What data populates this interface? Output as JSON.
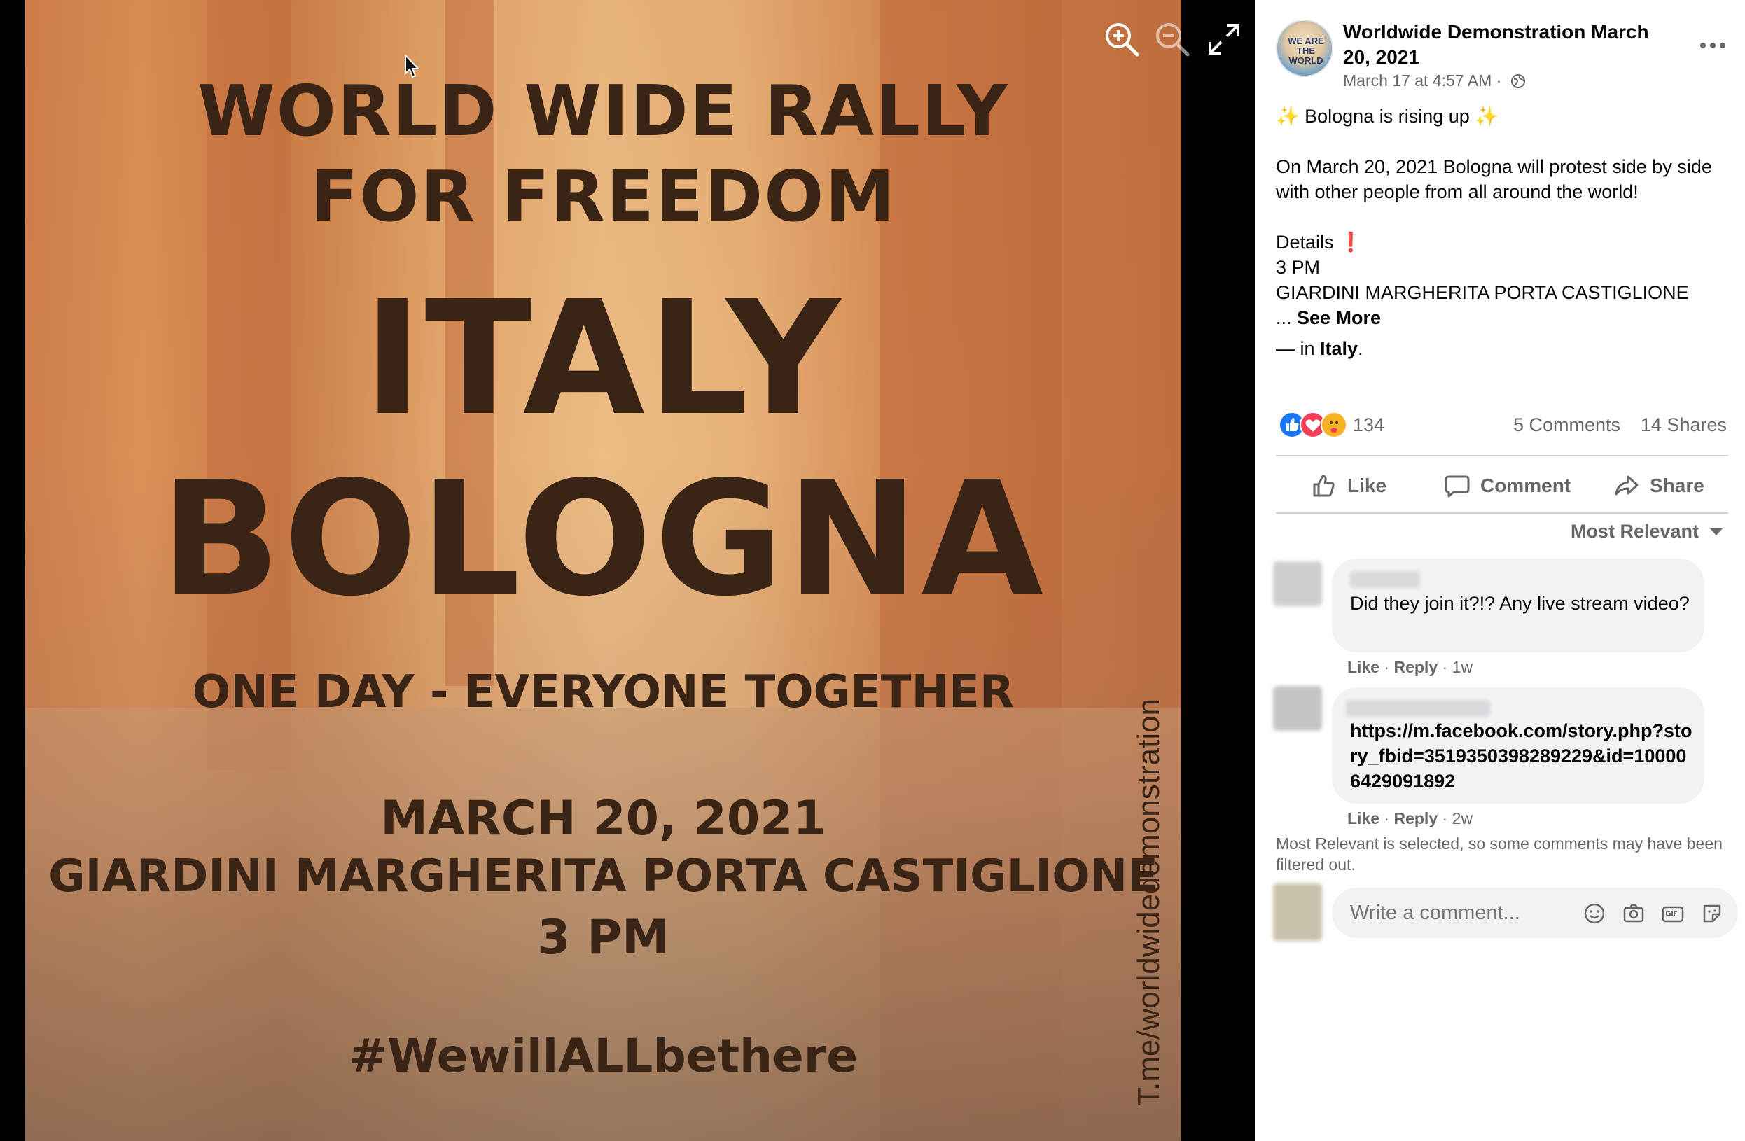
{
  "poster": {
    "line1": "WORLD WIDE RALLY",
    "line2": "FOR FREEDOM",
    "country": "ITALY",
    "city": "BOLOGNA",
    "tagline": "ONE DAY - EVERYONE TOGETHER",
    "date": "MARCH 20, 2021",
    "venue": "GIARDINI MARGHERITA PORTA CASTIGLIONE",
    "time": "3 PM",
    "hashtag": "#WewillALLbethere",
    "side_url": "T.me/worldwidedemonstration"
  },
  "viewer": {
    "zoom_in_icon": "zoom-in-icon",
    "zoom_out_icon": "zoom-out-icon",
    "fullscreen_icon": "fullscreen-icon"
  },
  "post": {
    "avatar_text": "WE ARE THE WORLD",
    "author": "Worldwide Demonstration March 20, 2021",
    "meta": "March 17 at 4:57 AM · ",
    "body_line1": "✨ Bologna is rising up ✨",
    "body_line2": "On March 20, 2021 Bologna will protest side by side with other people from all around the world!",
    "details_label": "Details ❗",
    "details_time": "3 PM",
    "details_place": "GIARDINI MARGHERITA PORTA CASTIGLIONE",
    "see_more_prefix": "... ",
    "see_more": "See More",
    "location_prefix": "— in ",
    "location": "Italy",
    "location_suffix": "."
  },
  "stats": {
    "reactions": "134",
    "comments": "5 Comments",
    "shares": "14 Shares"
  },
  "actions": {
    "like": "Like",
    "comment": "Comment",
    "share": "Share"
  },
  "sort": {
    "label": "Most Relevant"
  },
  "comments": [
    {
      "text": "Did they join it?!? Any live stream video?",
      "like": "Like",
      "reply": "Reply",
      "time": "1w"
    },
    {
      "text": "https://m.facebook.com/story.php?story_fbid=3519350398289229&id=100006429091892",
      "like": "Like",
      "reply": "Reply",
      "time": "2w"
    }
  ],
  "filter_note": "Most Relevant is selected, so some comments may have been filtered out.",
  "composer": {
    "placeholder": "Write a comment..."
  },
  "colors": {
    "facebook_blue": "#1877f2",
    "love_red": "#f33e58",
    "care_yellow": "#f7b125",
    "secondary_text": "#65676b",
    "bubble_bg": "#f0f2f5"
  }
}
